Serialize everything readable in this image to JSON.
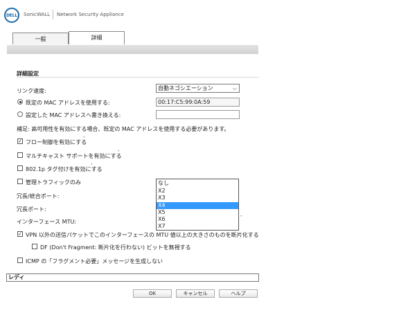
{
  "header": {
    "logo_text": "DELL",
    "brand": "SonicWALL",
    "product": "Network Security Appliance"
  },
  "tabs": [
    {
      "label": "一般",
      "active": false
    },
    {
      "label": "詳細",
      "active": true
    }
  ],
  "section_title": "詳細設定",
  "link_speed": {
    "label": "リンク速度:",
    "value": "自動ネゴシエーション"
  },
  "mac": {
    "default_label": "既定の MAC アドレスを使用する:",
    "default_value": "00:17:C5:99:0A:59",
    "override_label": "設定した MAC アドレスへ書き換える:",
    "override_value": ""
  },
  "notice": "補足: 高可用性を有効にする場合、既定の MAC アドレスを使用する必要があります。",
  "options": {
    "flow_control": "フロー制御を有効にする",
    "multicast": "マルチキャスト サポートを有効にする",
    "vlan_tag": "802.1p タグ付けを有効にする",
    "mgmt_traffic": "管理トラフィックのみ"
  },
  "redundant_agg_label": "冗長/統合ポート:",
  "redundant_label": "冗長ポート:",
  "mtu_label": "インターフェース MTU:",
  "vpn_option": "VPN 以外の送信パケットでこのインターフェースの MTU 値以上の大きさのものを断片化する",
  "df_option": "DF (Don't Fragment: 断片化を行わない) ビットを無視する",
  "icmp_option": "ICMP の「フラグメント必要」メッセージを生成しない",
  "dropdown": {
    "options": [
      "なし",
      "X2",
      "X3",
      "X4",
      "X5",
      "X6",
      "X7"
    ],
    "selected_index": 3,
    "selected_color": "#3399ff"
  },
  "status": "レディ",
  "buttons": {
    "ok": "OK",
    "cancel": "キャンセル",
    "help": "ヘルプ"
  }
}
